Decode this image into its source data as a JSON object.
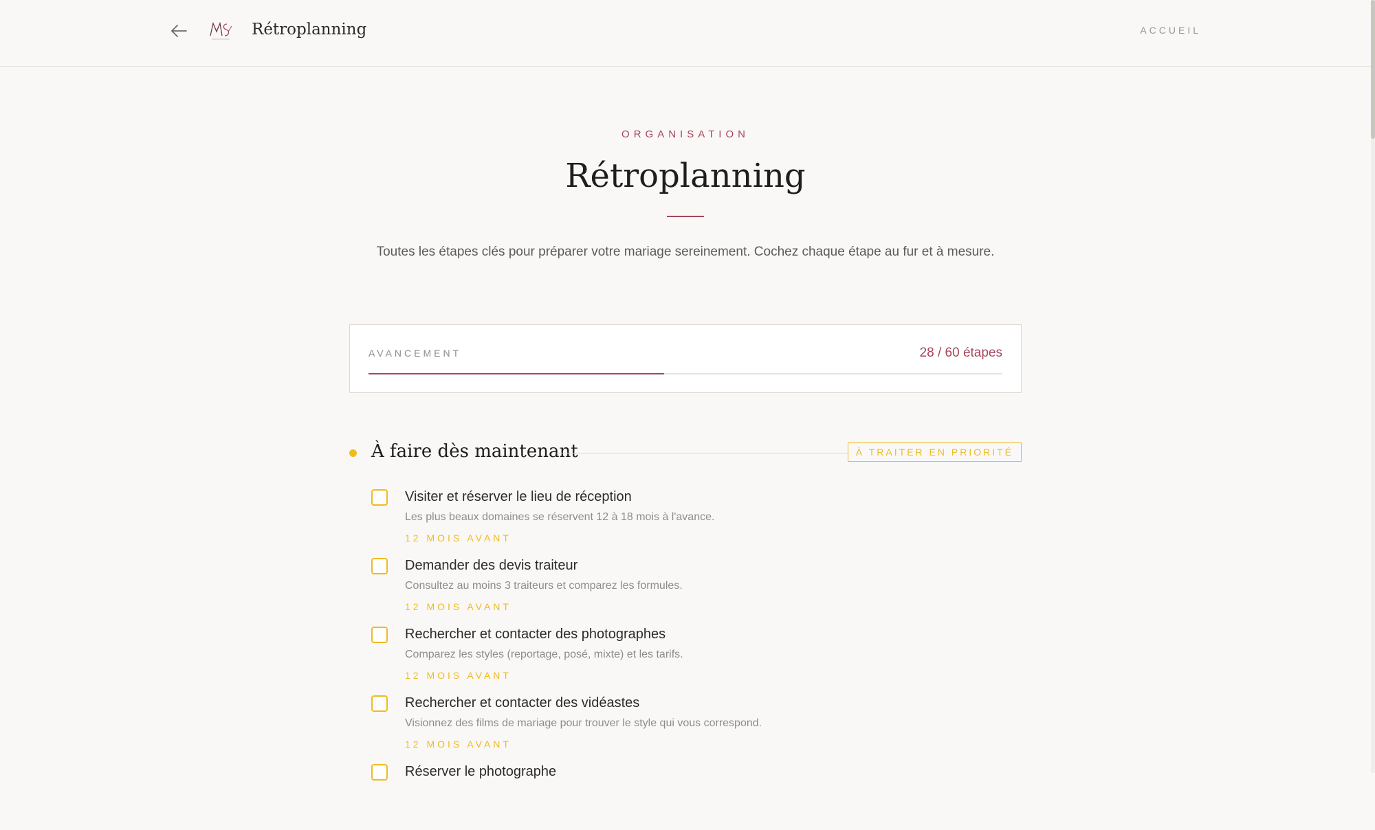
{
  "header": {
    "title": "Rétroplanning",
    "nav_home": "ACCUEIL"
  },
  "hero": {
    "eyebrow": "ORGANISATION",
    "title": "Rétroplanning",
    "subtitle": "Toutes les étapes clés pour préparer votre mariage sereinement. Cochez chaque étape au fur et à mesure."
  },
  "progress": {
    "label": "AVANCEMENT",
    "count_text": "28 / 60 étapes",
    "completed": 28,
    "total": 60
  },
  "section": {
    "title": "À faire dès maintenant",
    "badge": "À TRAITER EN PRIORITÉ",
    "tasks": [
      {
        "title": "Visiter et réserver le lieu de réception",
        "description": "Les plus beaux domaines se réservent 12 à 18 mois à l'avance.",
        "timing": "12 MOIS AVANT"
      },
      {
        "title": "Demander des devis traiteur",
        "description": "Consultez au moins 3 traiteurs et comparez les formules.",
        "timing": "12 MOIS AVANT"
      },
      {
        "title": "Rechercher et contacter des photographes",
        "description": "Comparez les styles (reportage, posé, mixte) et les tarifs.",
        "timing": "12 MOIS AVANT"
      },
      {
        "title": "Rechercher et contacter des vidéastes",
        "description": "Visionnez des films de mariage pour trouver le style qui vous correspond.",
        "timing": "12 MOIS AVANT"
      },
      {
        "title": "Réserver le photographe",
        "description": "",
        "timing": ""
      }
    ]
  },
  "colors": {
    "accent": "#a4465c",
    "priority": "#f0bb1f",
    "background": "#f9f8f6"
  },
  "icons": {
    "back": "arrow-left-icon",
    "logo": "brand-logo-icon"
  }
}
